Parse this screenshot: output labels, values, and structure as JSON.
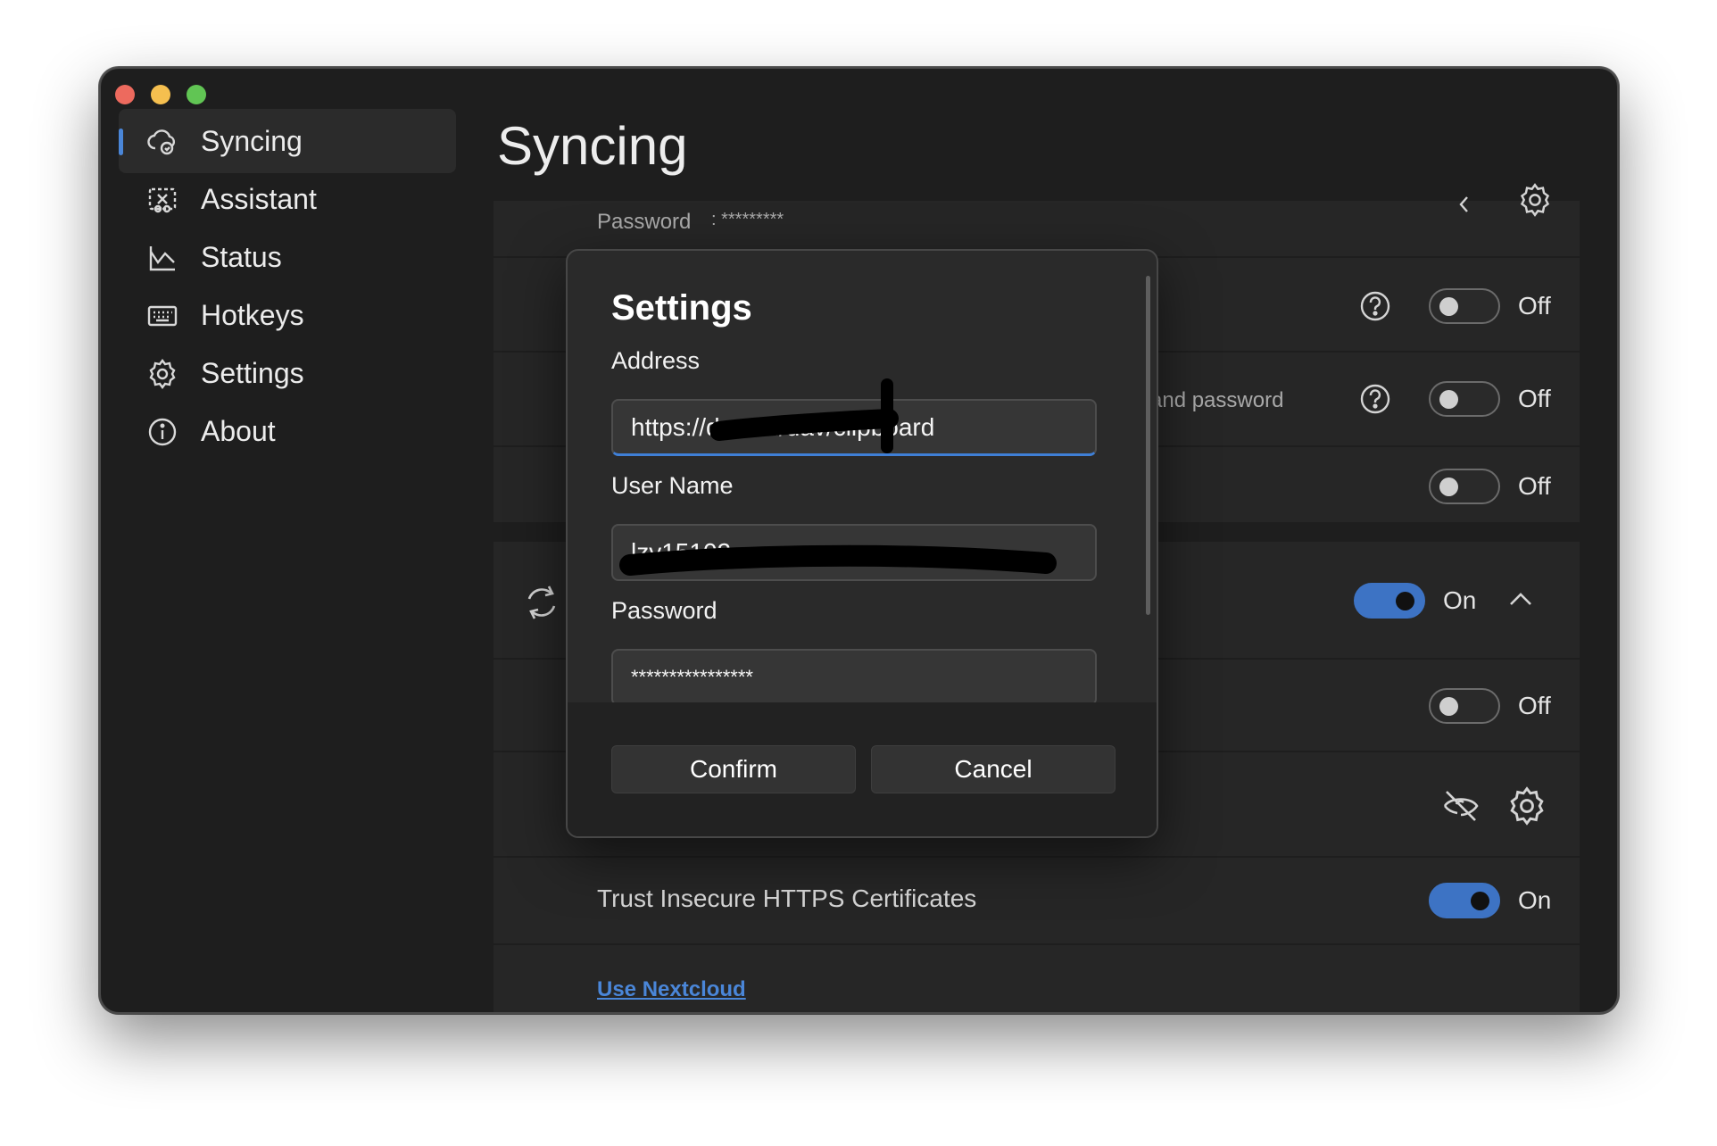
{
  "window": {
    "title": "Syncing"
  },
  "sidebar": {
    "items": [
      {
        "label": "Syncing",
        "icon": "cloud-sync-icon",
        "active": true
      },
      {
        "label": "Assistant",
        "icon": "assistant-icon",
        "active": false
      },
      {
        "label": "Status",
        "icon": "chart-icon",
        "active": false
      },
      {
        "label": "Hotkeys",
        "icon": "keyboard-icon",
        "active": false
      },
      {
        "label": "Settings",
        "icon": "gear-icon",
        "active": false
      },
      {
        "label": "About",
        "icon": "info-icon",
        "active": false
      }
    ]
  },
  "main": {
    "rows": {
      "password_row": {
        "label": "Password",
        "value": ": *********"
      },
      "row1": {
        "toggle_state": "Off"
      },
      "row2": {
        "text": "and password",
        "toggle_state": "Off"
      },
      "row3": {
        "toggle_state": "Off"
      },
      "sync_row": {
        "toggle_state": "On"
      },
      "row5": {
        "toggle_state": "Off"
      },
      "trust_row": {
        "label": "Trust Insecure HTTPS Certificates",
        "toggle_state": "On"
      },
      "nextcloud_link": "Use Nextcloud"
    }
  },
  "dialog": {
    "title": "Settings",
    "address_label": "Address",
    "address_value": "https://dav.        m/dav/clipboard",
    "username_label": "User Name",
    "username_value": "lzv15102",
    "password_label": "Password",
    "password_value": "****************",
    "confirm_label": "Confirm",
    "cancel_label": "Cancel"
  },
  "colors": {
    "accent": "#3d73c4",
    "link": "#4a86d8",
    "window_bg": "#1e1e1e",
    "panel_bg": "#262626"
  }
}
